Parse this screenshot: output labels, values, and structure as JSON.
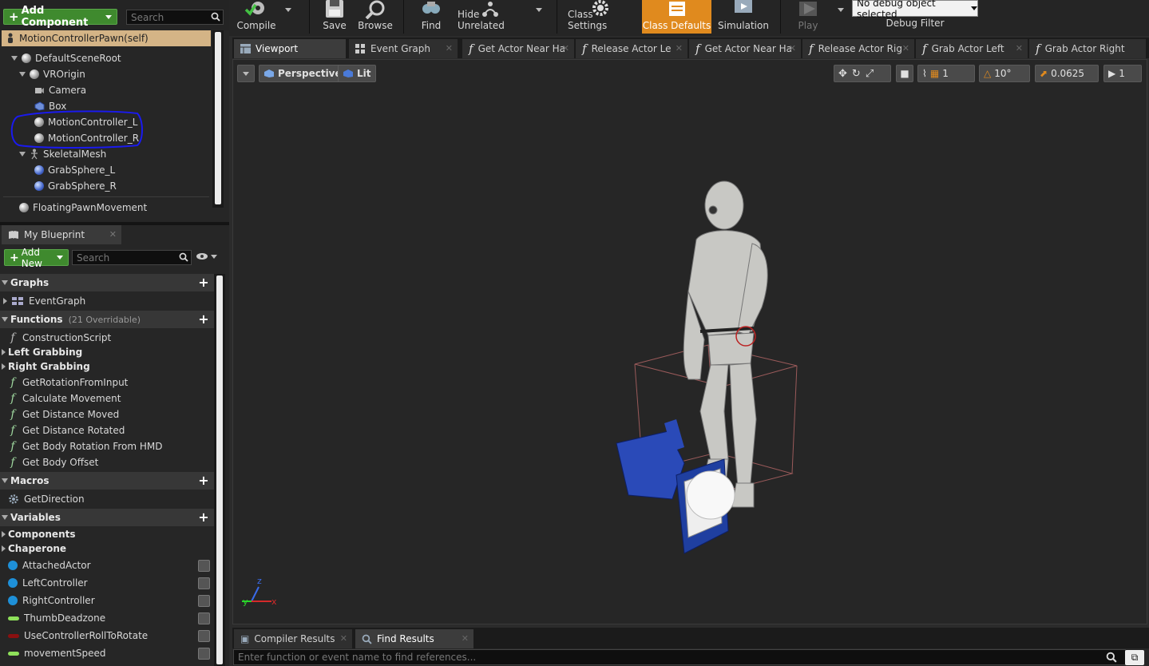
{
  "components": {
    "add_button": "Add Component",
    "search_placeholder": "Search",
    "self": "MotionControllerPawn(self)",
    "tree": [
      {
        "label": "DefaultSceneRoot"
      },
      {
        "label": "VROrigin"
      },
      {
        "label": "Camera"
      },
      {
        "label": "Box"
      },
      {
        "label": "MotionController_L"
      },
      {
        "label": "MotionController_R"
      },
      {
        "label": "SkeletalMesh"
      },
      {
        "label": "GrabSphere_L"
      },
      {
        "label": "GrabSphere_R"
      },
      {
        "label": "FloatingPawnMovement"
      }
    ]
  },
  "toolbar": {
    "compile": "Compile",
    "save": "Save",
    "browse": "Browse",
    "find": "Find",
    "hide_unrelated": "Hide Unrelated",
    "class_settings": "Class Settings",
    "class_defaults": "Class Defaults",
    "simulation": "Simulation",
    "play": "Play",
    "debug_select": "No debug object selected",
    "debug_filter": "Debug Filter"
  },
  "tabs": [
    {
      "label": "Viewport"
    },
    {
      "label": "Event Graph"
    },
    {
      "label": "Get Actor Near Ha"
    },
    {
      "label": "Release Actor Le"
    },
    {
      "label": "Get Actor Near Ha"
    },
    {
      "label": "Release Actor Rig"
    },
    {
      "label": "Grab Actor Left"
    },
    {
      "label": "Grab Actor Right"
    }
  ],
  "viewport": {
    "perspective": "Perspective",
    "lit": "Lit",
    "grid_value": "1",
    "rot_value": "10°",
    "scale_value": "0.0625",
    "cam_speed": "1",
    "axis_z": "z",
    "axis_y": "y",
    "axis_x": "x"
  },
  "my_blueprint": {
    "tab": "My Blueprint",
    "add_new": "Add New",
    "search_placeholder": "Search",
    "graphs_header": "Graphs",
    "event_graph": "EventGraph",
    "functions_header": "Functions",
    "functions_overridable": "(21 Overridable)",
    "construction_script": "ConstructionScript",
    "left_grabbing": "Left Grabbing",
    "right_grabbing": "Right Grabbing",
    "functions": [
      "GetRotationFromInput",
      "Calculate Movement",
      "Get Distance Moved",
      "Get Distance Rotated",
      "Get Body Rotation From HMD",
      "Get Body Offset"
    ],
    "macros_header": "Macros",
    "get_direction": "GetDirection",
    "variables_header": "Variables",
    "components_cat": "Components",
    "chaperone_cat": "Chaperone",
    "variables": [
      {
        "name": "AttachedActor",
        "color": "#1e90d8"
      },
      {
        "name": "LeftController",
        "color": "#1e90d8"
      },
      {
        "name": "RightController",
        "color": "#1e90d8"
      },
      {
        "name": "ThumbDeadzone",
        "color": "#8ee05a"
      },
      {
        "name": "UseControllerRollToRotate",
        "color": "#8a1010"
      },
      {
        "name": "movementSpeed",
        "color": "#8ee05a"
      }
    ]
  },
  "bottom": {
    "compiler_results": "Compiler Results",
    "find_results": "Find Results",
    "find_placeholder": "Enter function or event name to find references..."
  },
  "colors": {
    "accent_orange": "#e08a1e",
    "add_green": "#3f8a2e",
    "self_row": "#d4b486"
  }
}
